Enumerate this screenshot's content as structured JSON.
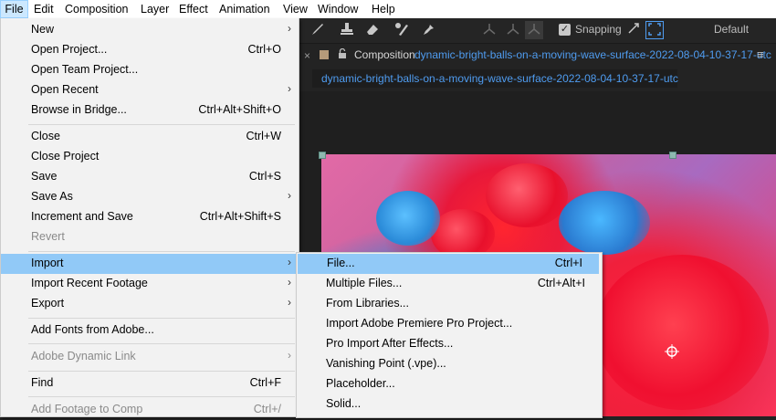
{
  "menubar": {
    "items": [
      {
        "label": "File"
      },
      {
        "label": "Edit"
      },
      {
        "label": "Composition"
      },
      {
        "label": "Layer"
      },
      {
        "label": "Effect"
      },
      {
        "label": "Animation"
      },
      {
        "label": "View"
      },
      {
        "label": "Window"
      },
      {
        "label": "Help"
      }
    ]
  },
  "toolbar": {
    "snapping_label": "Snapping",
    "snapping_checked": true,
    "workspace_label": "Default",
    "icons": [
      "brush-icon",
      "clone-stamp-icon",
      "eraser-icon",
      "roto-brush-icon",
      "puppet-pin-icon",
      "axis-icon",
      "snap-icon",
      "expand-icon",
      "fullscreen-icon"
    ]
  },
  "composition": {
    "prefix": "Composition",
    "name": "dynamic-bright-balls-on-a-moving-wave-surface-2022-08-04-10-37-17-utc",
    "menu_glyph": "≡",
    "subtab": "dynamic-bright-balls-on-a-moving-wave-surface-2022-08-04-10-37-17-utc"
  },
  "file_menu": {
    "items": [
      {
        "label": "New",
        "shortcut": "",
        "submenu": true,
        "disabled": false
      },
      {
        "label": "Open Project...",
        "shortcut": "Ctrl+O",
        "submenu": false,
        "disabled": false
      },
      {
        "label": "Open Team Project...",
        "shortcut": "",
        "submenu": false,
        "disabled": false
      },
      {
        "label": "Open Recent",
        "shortcut": "",
        "submenu": true,
        "disabled": false
      },
      {
        "label": "Browse in Bridge...",
        "shortcut": "Ctrl+Alt+Shift+O",
        "submenu": false,
        "disabled": false
      },
      {
        "label": "Close",
        "shortcut": "Ctrl+W",
        "submenu": false,
        "disabled": false
      },
      {
        "label": "Close Project",
        "shortcut": "",
        "submenu": false,
        "disabled": false
      },
      {
        "label": "Save",
        "shortcut": "Ctrl+S",
        "submenu": false,
        "disabled": false
      },
      {
        "label": "Save As",
        "shortcut": "",
        "submenu": true,
        "disabled": false
      },
      {
        "label": "Increment and Save",
        "shortcut": "Ctrl+Alt+Shift+S",
        "submenu": false,
        "disabled": false
      },
      {
        "label": "Revert",
        "shortcut": "",
        "submenu": false,
        "disabled": true
      },
      {
        "label": "Import",
        "shortcut": "",
        "submenu": true,
        "disabled": false,
        "highlighted": true
      },
      {
        "label": "Import Recent Footage",
        "shortcut": "",
        "submenu": true,
        "disabled": false
      },
      {
        "label": "Export",
        "shortcut": "",
        "submenu": true,
        "disabled": false
      },
      {
        "label": "Add Fonts from Adobe...",
        "shortcut": "",
        "submenu": false,
        "disabled": false
      },
      {
        "label": "Adobe Dynamic Link",
        "shortcut": "",
        "submenu": true,
        "disabled": true
      },
      {
        "label": "Find",
        "shortcut": "Ctrl+F",
        "submenu": false,
        "disabled": false
      },
      {
        "label": "Add Footage to Comp",
        "shortcut": "Ctrl+/",
        "submenu": false,
        "disabled": true
      }
    ],
    "submenu_arrow": "›"
  },
  "import_menu": {
    "items": [
      {
        "label": "File...",
        "shortcut": "Ctrl+I",
        "highlighted": true
      },
      {
        "label": "Multiple Files...",
        "shortcut": "Ctrl+Alt+I"
      },
      {
        "label": "From Libraries...",
        "shortcut": ""
      },
      {
        "label": "Import Adobe Premiere Pro Project...",
        "shortcut": ""
      },
      {
        "label": "Pro Import After Effects...",
        "shortcut": ""
      },
      {
        "label": "Vanishing Point (.vpe)...",
        "shortcut": ""
      },
      {
        "label": "Placeholder...",
        "shortcut": ""
      },
      {
        "label": "Solid...",
        "shortcut": ""
      }
    ]
  },
  "colors": {
    "menu_bg": "#f2f2f2",
    "menu_highlight": "#91c9f7",
    "accent_link": "#4f9cf0",
    "panel_bg": "#232323"
  }
}
